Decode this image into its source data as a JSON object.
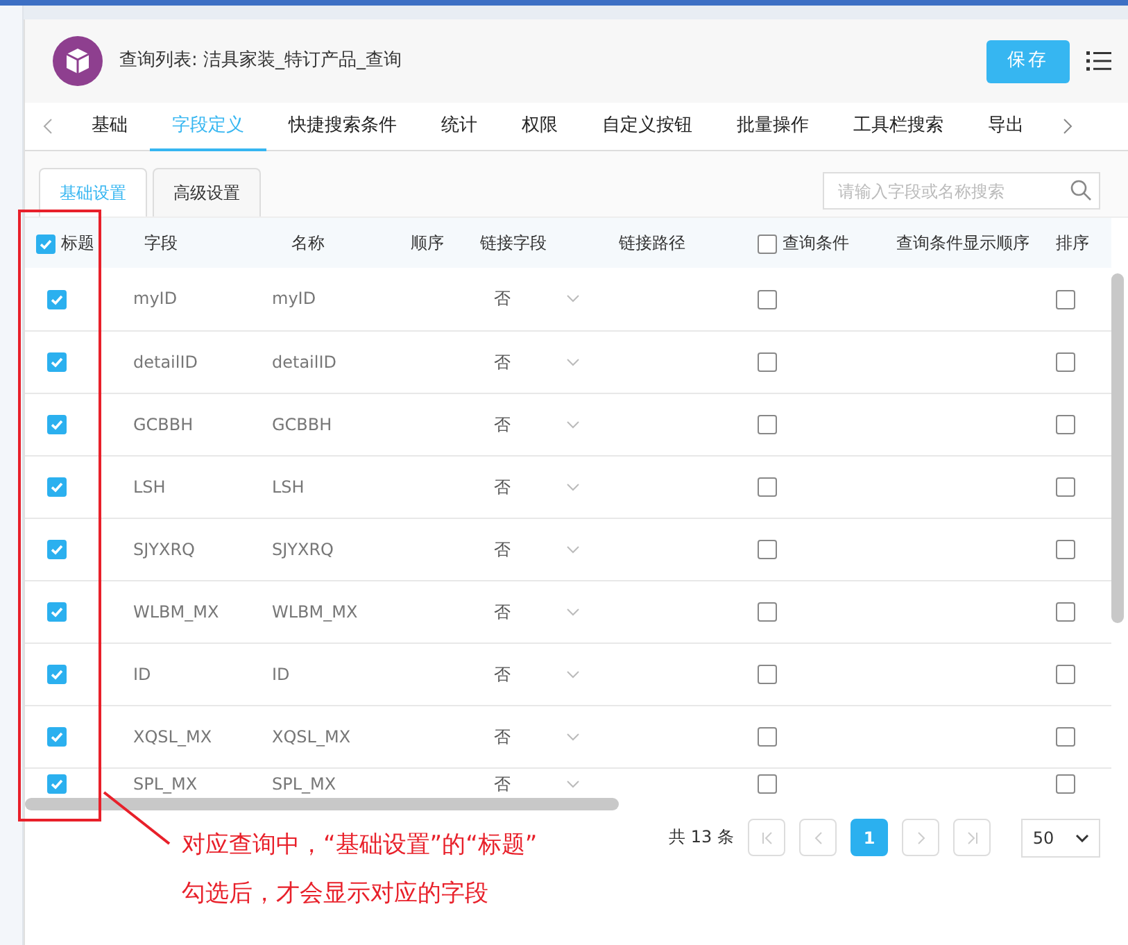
{
  "header": {
    "title": "查询列表: 洁具家装_特订产品_查询",
    "save_button": "保存"
  },
  "tabs": [
    {
      "label": "基础",
      "selected": false
    },
    {
      "label": "字段定义",
      "selected": true
    },
    {
      "label": "快捷搜索条件",
      "selected": false
    },
    {
      "label": "统计",
      "selected": false
    },
    {
      "label": "权限",
      "selected": false
    },
    {
      "label": "自定义按钮",
      "selected": false
    },
    {
      "label": "批量操作",
      "selected": false
    },
    {
      "label": "工具栏搜索",
      "selected": false
    },
    {
      "label": "导出",
      "selected": false
    }
  ],
  "subtabs": [
    {
      "label": "基础设置",
      "selected": true
    },
    {
      "label": "高级设置",
      "selected": false
    }
  ],
  "search": {
    "placeholder": "请输入字段或名称搜索"
  },
  "table": {
    "columns": [
      {
        "label": "标题",
        "checked": true
      },
      {
        "label": "字段"
      },
      {
        "label": "名称"
      },
      {
        "label": "顺序"
      },
      {
        "label": "链接字段"
      },
      {
        "label": "链接路径"
      },
      {
        "label": "查询条件",
        "checked": false
      },
      {
        "label": "查询条件显示顺序"
      },
      {
        "label": "排序"
      }
    ],
    "rows": [
      {
        "title_checked": true,
        "field": "myID",
        "name": "myID",
        "link": "否",
        "query_checked": false,
        "sort_checked": false
      },
      {
        "title_checked": true,
        "field": "detailID",
        "name": "detailID",
        "link": "否",
        "query_checked": false,
        "sort_checked": false
      },
      {
        "title_checked": true,
        "field": "GCBBH",
        "name": "GCBBH",
        "link": "否",
        "query_checked": false,
        "sort_checked": false
      },
      {
        "title_checked": true,
        "field": "LSH",
        "name": "LSH",
        "link": "否",
        "query_checked": false,
        "sort_checked": false
      },
      {
        "title_checked": true,
        "field": "SJYXRQ",
        "name": "SJYXRQ",
        "link": "否",
        "query_checked": false,
        "sort_checked": false
      },
      {
        "title_checked": true,
        "field": "WLBM_MX",
        "name": "WLBM_MX",
        "link": "否",
        "query_checked": false,
        "sort_checked": false
      },
      {
        "title_checked": true,
        "field": "ID",
        "name": "ID",
        "link": "否",
        "query_checked": false,
        "sort_checked": false
      },
      {
        "title_checked": true,
        "field": "XQSL_MX",
        "name": "XQSL_MX",
        "link": "否",
        "query_checked": false,
        "sort_checked": false
      },
      {
        "title_checked": true,
        "field": "SPL_MX",
        "name": "SPL_MX",
        "link": "否",
        "query_checked": false,
        "sort_checked": false
      }
    ]
  },
  "pagination": {
    "total": "共 13 条",
    "pages": [
      {
        "label": "1",
        "selected": true
      }
    ],
    "page_size": "50"
  },
  "annotation": {
    "lines": [
      "对应查询中，“基础设置”的“标题”",
      "勾选后，才会显示对应的字段"
    ]
  }
}
